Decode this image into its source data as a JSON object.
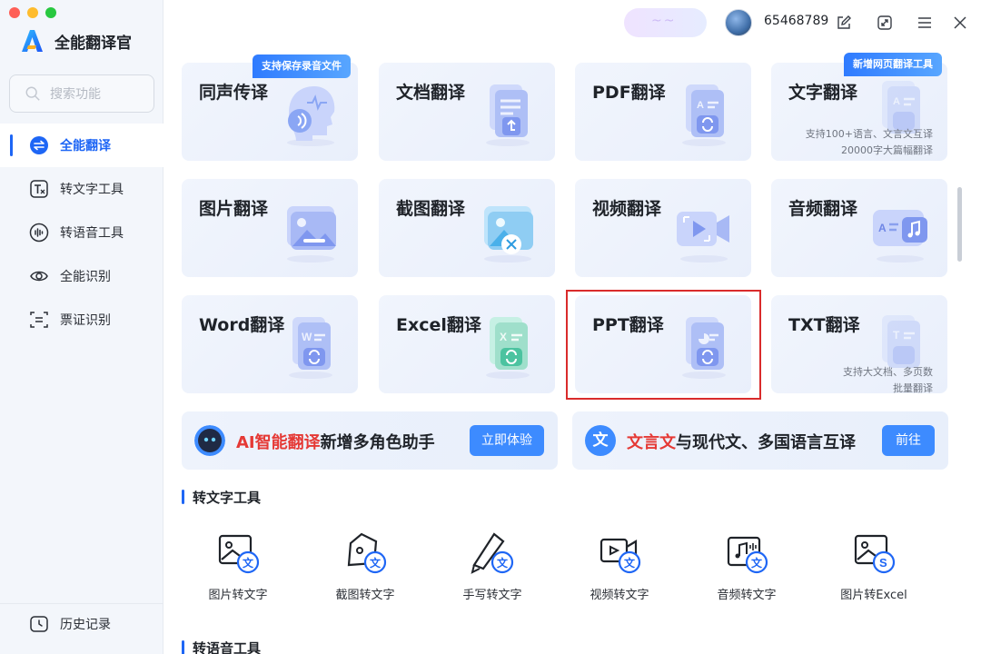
{
  "app": {
    "name": "全能翻译官"
  },
  "sidebar": {
    "search_placeholder": "搜索功能",
    "items": [
      {
        "label": "全能翻译",
        "icon": "translate-icon",
        "active": true
      },
      {
        "label": "转文字工具",
        "icon": "text-tool-icon"
      },
      {
        "label": "转语音工具",
        "icon": "voice-tool-icon"
      },
      {
        "label": "全能识别",
        "icon": "eye-scan-icon"
      },
      {
        "label": "票证识别",
        "icon": "ticket-scan-icon"
      }
    ],
    "history": "历史记录"
  },
  "topbar": {
    "user_id": "65468789"
  },
  "cards": [
    {
      "title": "同声传译",
      "badge": "支持保存录音文件",
      "icon": "head-audio-icon"
    },
    {
      "title": "文档翻译",
      "icon": "document-icon"
    },
    {
      "title": "PDF翻译",
      "icon": "pdf-doc-icon"
    },
    {
      "title": "文字翻译",
      "badge": "新增网页翻译工具",
      "sub1": "支持100+语言、文言文互译",
      "sub2": "20000字大篇幅翻译",
      "icon": "text-doc-icon"
    },
    {
      "title": "图片翻译",
      "icon": "image-icon"
    },
    {
      "title": "截图翻译",
      "icon": "screenshot-icon"
    },
    {
      "title": "视频翻译",
      "icon": "video-icon"
    },
    {
      "title": "音频翻译",
      "icon": "audio-icon"
    },
    {
      "title": "Word翻译",
      "icon": "word-doc-icon"
    },
    {
      "title": "Excel翻译",
      "icon": "excel-doc-icon"
    },
    {
      "title": "PPT翻译",
      "icon": "ppt-doc-icon"
    },
    {
      "title": "TXT翻译",
      "sub1": "支持大文档、多页数",
      "sub2": "批量翻译",
      "icon": "txt-doc-icon"
    }
  ],
  "banners": [
    {
      "highlight": "AI智能翻译",
      "text": "新增多角色助手",
      "button": "立即体验",
      "icon": "robot-icon"
    },
    {
      "icon_text": "文",
      "highlight": "文言文",
      "text": "与现代文、多国语言互译",
      "button": "前往"
    }
  ],
  "sections": [
    {
      "title": "转文字工具",
      "tools": [
        "图片转文字",
        "截图转文字",
        "手写转文字",
        "视频转文字",
        "音频转文字",
        "图片转Excel"
      ]
    },
    {
      "title": "转语音工具"
    }
  ],
  "colors": {
    "accent": "#1e66f5",
    "highlight_red": "#e53935",
    "button_blue": "#3d8bff"
  }
}
